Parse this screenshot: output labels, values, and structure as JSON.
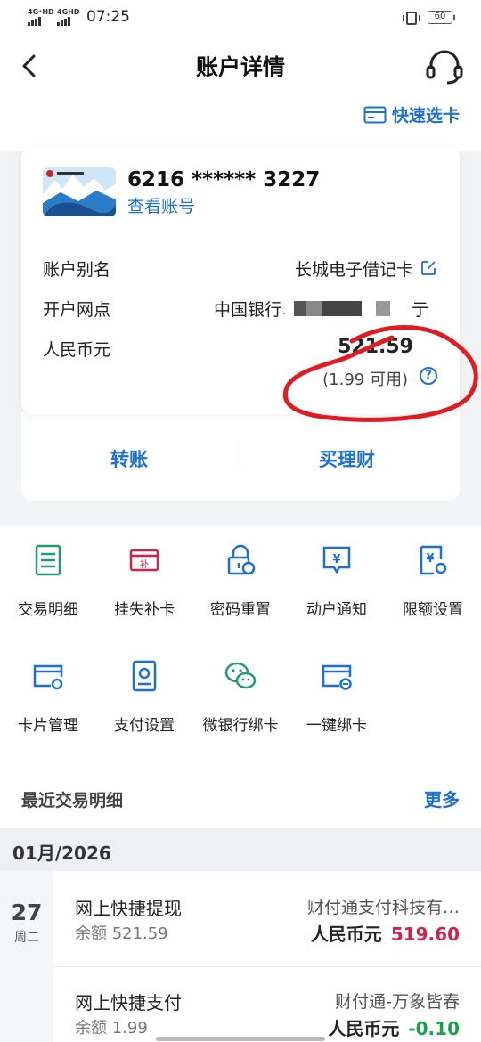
{
  "status_bar": {
    "signal1_label": "4G⁺HD",
    "signal2_label": "4GHD",
    "time": "07:25",
    "battery": "60"
  },
  "header": {
    "title": "账户详情",
    "quick_card_label": "快速选卡"
  },
  "account": {
    "card_number": "6216 ****** 3227",
    "view_account_label": "查看账号",
    "alias_label": "账户别名",
    "alias_value": "长城电子借记卡",
    "branch_label": "开户网点",
    "branch_value_prefix": "中国银行",
    "branch_value_suffix": "亍",
    "currency_label": "人民币元",
    "balance": "521.59",
    "available": "(1.99 可用)",
    "help_glyph": "?"
  },
  "actions": {
    "transfer_label": "转账",
    "wealth_label": "买理财"
  },
  "functions": [
    {
      "label": "交易明细",
      "icon": "transaction-detail-icon",
      "color": "#1f9d6b"
    },
    {
      "label": "挂失补卡",
      "icon": "report-loss-icon",
      "color": "#d6204a"
    },
    {
      "label": "密码重置",
      "icon": "password-reset-icon",
      "color": "#1c6fd9"
    },
    {
      "label": "动户通知",
      "icon": "account-notify-icon",
      "color": "#1c6fd9"
    },
    {
      "label": "限额设置",
      "icon": "limit-settings-icon",
      "color": "#1c6fd9"
    },
    {
      "label": "卡片管理",
      "icon": "card-manage-icon",
      "color": "#1c6fd9"
    },
    {
      "label": "支付设置",
      "icon": "payment-settings-icon",
      "color": "#1c6fd9"
    },
    {
      "label": "微银行绑卡",
      "icon": "wechat-bind-icon",
      "color": "#1f9d6b"
    },
    {
      "label": "一键绑卡",
      "icon": "one-click-bind-icon",
      "color": "#1c6fd9"
    }
  ],
  "recent": {
    "title": "最近交易明细",
    "more_label": "更多",
    "month": "01月/2026",
    "day": "27",
    "weekday": "周二",
    "transactions": [
      {
        "title": "网上快捷提现",
        "balance": "余额 521.59",
        "merchant": "财付通支付科技有…",
        "currency": "人民币元",
        "amount": "519.60"
      },
      {
        "title": "网上快捷支付",
        "balance": "余额 1.99",
        "merchant": "财付通-万象皆春",
        "currency": "人民币元",
        "amount": "-0.10"
      }
    ]
  }
}
